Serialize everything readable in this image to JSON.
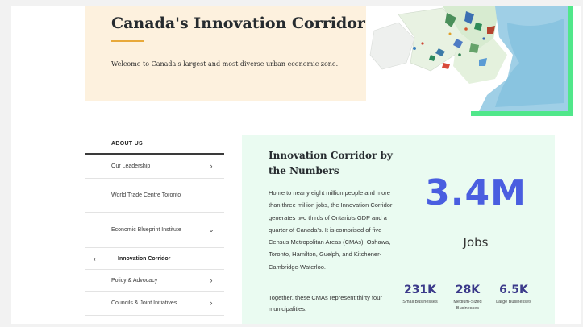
{
  "hero": {
    "title": "Canada's Innovation Corridor",
    "text": "Welcome to Canada's largest and most diverse urban economic zone.",
    "accent_color": "#e8a93a",
    "background_color": "#fdf1de"
  },
  "map": {
    "frame_color": "#50e78a",
    "icon": "regional-map-illustration"
  },
  "sidebar": {
    "heading": "ABOUT US",
    "items": [
      {
        "label": "Our Leadership",
        "icon": "chevron-right-icon",
        "glyph": "›"
      },
      {
        "label": "World Trade Centre Toronto",
        "icon": "",
        "glyph": ""
      },
      {
        "label": "Economic Blueprint Institute",
        "icon": "chevron-down-icon",
        "glyph": "⌄"
      },
      {
        "label": "Innovation Corridor",
        "icon": "arrow-left-icon",
        "glyph": "‹",
        "active": true
      },
      {
        "label": "Policy & Advocacy",
        "icon": "chevron-right-icon",
        "glyph": "›"
      },
      {
        "label": "Councils & Joint Initiatives",
        "icon": "chevron-right-icon",
        "glyph": "›"
      }
    ]
  },
  "stats": {
    "title": "Innovation Corridor by the Numbers",
    "paragraph1": "Home to nearly eight million people and more than three million jobs, the Innovation Corridor generates two thirds of Ontario's GDP and a quarter of Canada's. It is comprised of five Census Metropolitan Areas (CMAs): Oshawa, Toronto, Hamilton, Guelph, and Kitchener-Cambridge-Waterloo.",
    "paragraph2": "Together, these CMAs represent thirty four municipalities.",
    "big_value": "3.4M",
    "big_label": "Jobs",
    "big_color": "#4a5ee0",
    "breakdown": [
      {
        "value": "231K",
        "caption": "Small Businesses"
      },
      {
        "value": "28K",
        "caption": "Medium-Sized Businesses"
      },
      {
        "value": "6.5K",
        "caption": "Large Businesses"
      }
    ],
    "background_color": "#eafbf1"
  }
}
